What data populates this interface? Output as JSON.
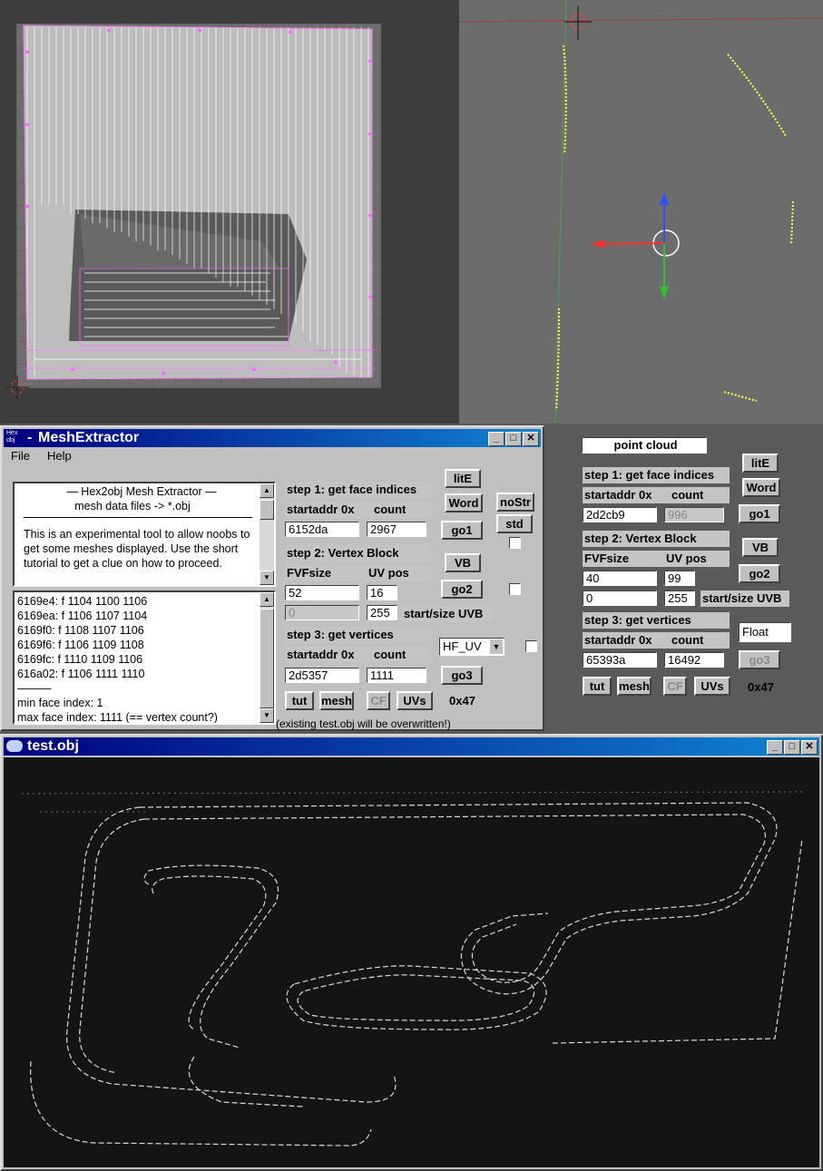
{
  "app": {
    "title": "MeshExtractor",
    "icon_text": "Hex obj",
    "title_prefix": " - ",
    "menu": [
      "File",
      "Help"
    ]
  },
  "info_box": {
    "heading": "—  Hex2obj Mesh Extractor  —",
    "subheading": "mesh data files -> *.obj",
    "body": "This is an experimental tool to allow noobs to get some meshes displayed. Use the short tutorial to get a clue on how to proceed."
  },
  "log_lines": [
    "6169e4: f  1104 1100 1106",
    "6169ea: f  1106 1107 1104",
    "6169f0: f  1108 1107 1106",
    "6169f6: f  1106 1109 1108",
    "6169fc: f  1110 1109 1106",
    "616a02: f  1106 1111 1110",
    "———",
    "min face index: 1",
    "max face index: 1111 (== vertex count?)"
  ],
  "left_panel": {
    "step1_label": "step 1: get face indices",
    "startaddr_label": "startaddr 0x",
    "count_label": "count",
    "step1_startaddr": "6152da",
    "step1_count": "2967",
    "step2_label": "step 2: Vertex Block",
    "fvfsize_label": "FVFsize",
    "uvpos_label": "UV pos",
    "fvfsize": "52",
    "uvpos": "16",
    "uvb_start": "0",
    "uvb_size": "255",
    "uvb_label": "start/size UVB",
    "step3_label": "step 3: get vertices",
    "step3_startaddr": "2d5357",
    "step3_count": "1111",
    "format_select": "HF_UV",
    "buttons": {
      "lite": "litE",
      "word": "Word",
      "nostr": "noStr",
      "std": "std",
      "go1": "go1",
      "vb": "VB",
      "go2": "go2",
      "go3": "go3",
      "tut": "tut",
      "mesh": "mesh",
      "cf": "CF",
      "uvs": "UVs"
    },
    "hex_value": "0x47",
    "status_text": "(existing test.obj will be overwritten!)"
  },
  "right_panel": {
    "point_cloud_label": "point cloud",
    "step1_label": "step 1: get face indices",
    "startaddr_label": "startaddr 0x",
    "count_label": "count",
    "step1_startaddr": "2d2cb9",
    "step1_count": "996",
    "step2_label": "step 2: Vertex Block",
    "fvfsize_label": "FVFsize",
    "uvpos_label": "UV pos",
    "fvfsize": "40",
    "uvpos": "99",
    "uvb_start": "0",
    "uvb_size": "255",
    "uvb_label": "start/size UVB",
    "step3_label": "step 3: get vertices",
    "format_select": "Float",
    "step3_startaddr": "65393a",
    "step3_count": "16492",
    "buttons": {
      "lite": "litE",
      "word": "Word",
      "go1": "go1",
      "vb": "VB",
      "go2": "go2",
      "go3": "go3",
      "tut": "tut",
      "mesh": "mesh",
      "cf": "CF",
      "uvs": "UVs"
    },
    "hex_value": "0x47"
  },
  "viewer": {
    "title": "test.obj"
  },
  "colors": {
    "titlebar_start": "#000080",
    "titlebar_end": "#1084d0",
    "uv_edges": "#ff66ff",
    "point_cloud": "#ffff40",
    "viewer_bg": "#141414"
  }
}
